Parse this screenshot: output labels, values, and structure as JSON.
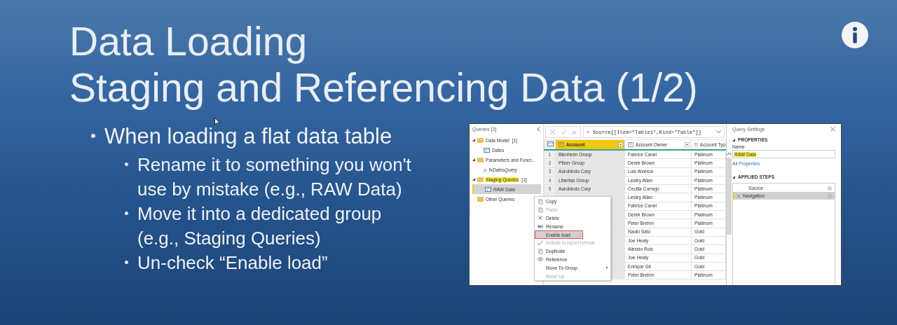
{
  "slide": {
    "title_lines": [
      "Data Loading",
      "Staging and Referencing Data (1/2)"
    ],
    "bullets": [
      {
        "text": "When loading a flat data table",
        "children": [
          {
            "text": "Rename it to something you won't use by mistake (e.g., RAW Data)"
          },
          {
            "text": "Move it into a dedicated group (e.g., Staging Queries)"
          },
          {
            "text": "Un-check “Enable load”"
          }
        ]
      }
    ]
  },
  "screenshot": {
    "queries": {
      "title": "Queries [3]",
      "tree": [
        {
          "kind": "folder",
          "label": "Data Model",
          "count": "[1]",
          "highlighted": false,
          "children": [
            {
              "kind": "table",
              "label": "Dates",
              "load_enabled": true,
              "selected": false
            }
          ]
        },
        {
          "kind": "folder",
          "label": "Parameters and Funct...",
          "highlighted": false,
          "children": [
            {
              "kind": "function",
              "glyph": "fx",
              "label": "fxDatesQuery",
              "load_enabled": false,
              "selected": false
            }
          ]
        },
        {
          "kind": "folder",
          "label": "Staging Queries",
          "count": "[1]",
          "highlighted": true,
          "children": [
            {
              "kind": "table",
              "label": "RAW Data",
              "load_enabled": false,
              "selected": true
            }
          ]
        },
        {
          "kind": "folder",
          "label": "Other Queries",
          "highlighted": false
        }
      ]
    },
    "formula_bar": {
      "fx_label": "fx",
      "formula": "= Source{[Item=\"Table1\",Kind=\"Table\"]}"
    },
    "grid": {
      "columns": [
        {
          "name": "Account",
          "selected": true
        },
        {
          "name": "Account Owner",
          "selected": false
        },
        {
          "name": "Account Typ",
          "selected": false
        }
      ],
      "rows": [
        {
          "num": "1",
          "account": "Blenheim Group",
          "owner": "Fabrice Canel",
          "type": "Platinum"
        },
        {
          "num": "2",
          "account": "Pfizer Group",
          "owner": "Derek Brown",
          "type": "Platinum"
        },
        {
          "num": "3",
          "account": "Aurobindo Corp",
          "owner": "Luis Alverca",
          "type": "Platinum"
        },
        {
          "num": "4",
          "account": "Libertas Group",
          "owner": "Lesley Allan",
          "type": "Platinum"
        },
        {
          "num": "5",
          "account": "Aurobindo Corp",
          "owner": "Cecilia Cornejo",
          "type": "Platinum"
        },
        {
          "owner": "Lesley Allan",
          "type": "Platinum"
        },
        {
          "owner": "Fabrice Canel",
          "type": "Platinum"
        },
        {
          "owner": "Derek Brown",
          "type": "Platinum"
        },
        {
          "owner": "Peter Brehm",
          "type": "Platinum"
        },
        {
          "owner": "Naoki Sato",
          "type": "Gold"
        },
        {
          "owner": "Joe Healy",
          "type": "Gold"
        },
        {
          "owner": "Alessio Roic",
          "type": "Gold"
        },
        {
          "owner": "Joe Healy",
          "type": "Gold"
        },
        {
          "owner": "Enrique Gil",
          "type": "Gold"
        },
        {
          "owner": "Peter Brehm",
          "type": "Platinum"
        }
      ]
    },
    "context_menu": {
      "items": [
        {
          "label": "Copy",
          "disabled": false,
          "highlighted": false,
          "submenu": false
        },
        {
          "label": "Paste",
          "disabled": true,
          "highlighted": false,
          "submenu": false
        },
        {
          "label": "Delete",
          "disabled": false,
          "highlighted": false,
          "submenu": false
        },
        {
          "label": "Rename",
          "disabled": false,
          "highlighted": false,
          "submenu": false
        },
        {
          "label": "Enable load",
          "disabled": false,
          "highlighted": true,
          "submenu": false
        },
        {
          "label": "Include in report refresh",
          "disabled": true,
          "highlighted": false,
          "submenu": false,
          "checked": true
        },
        {
          "label": "Duplicate",
          "disabled": false,
          "highlighted": false,
          "submenu": false
        },
        {
          "label": "Reference",
          "disabled": false,
          "highlighted": false,
          "submenu": false
        },
        {
          "label": "Move To Group",
          "disabled": false,
          "highlighted": false,
          "submenu": true
        },
        {
          "label": "Move Up",
          "disabled": true,
          "highlighted": false,
          "submenu": false
        }
      ]
    },
    "settings": {
      "title": "Query Settings",
      "properties_heading": "PROPERTIES",
      "name_label": "Name",
      "name_value": "RAW Data",
      "name_highlighted": true,
      "all_properties_link": "All Properties",
      "steps_heading": "APPLIED STEPS",
      "steps": [
        {
          "label": "Source",
          "selected": false
        },
        {
          "label": "Navigation",
          "selected": true
        }
      ]
    }
  }
}
